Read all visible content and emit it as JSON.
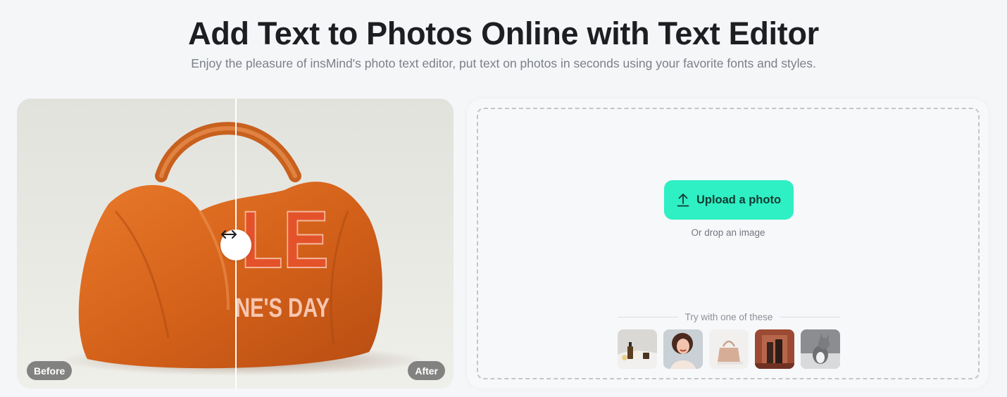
{
  "hero": {
    "title": "Add Text to Photos Online with Text Editor",
    "subtitle": "Enjoy the pleasure of insMind's photo text editor, put text on photos in seconds using your favorite fonts and styles."
  },
  "comparison": {
    "before_label": "Before",
    "after_label": "After",
    "overlay_text_line1": "LE",
    "overlay_text_line2": "NE'S DAY",
    "handle_icon": "left-right-arrow-icon",
    "colors": {
      "bag": "#d9661c",
      "overlay_text": "#e4522a",
      "overlay_subtext": "#f7c6b0",
      "background": "#e6e6e1"
    }
  },
  "upload": {
    "button_label": "Upload a photo",
    "button_icon": "upload-arrow-icon",
    "drop_hint": "Or drop an image",
    "try_label": "Try with one of these",
    "accent_color": "#2ff0c4",
    "samples": [
      {
        "name": "skincare-products"
      },
      {
        "name": "smiling-woman"
      },
      {
        "name": "pink-handbag"
      },
      {
        "name": "cosmetic-bottles"
      },
      {
        "name": "kitten"
      }
    ]
  }
}
